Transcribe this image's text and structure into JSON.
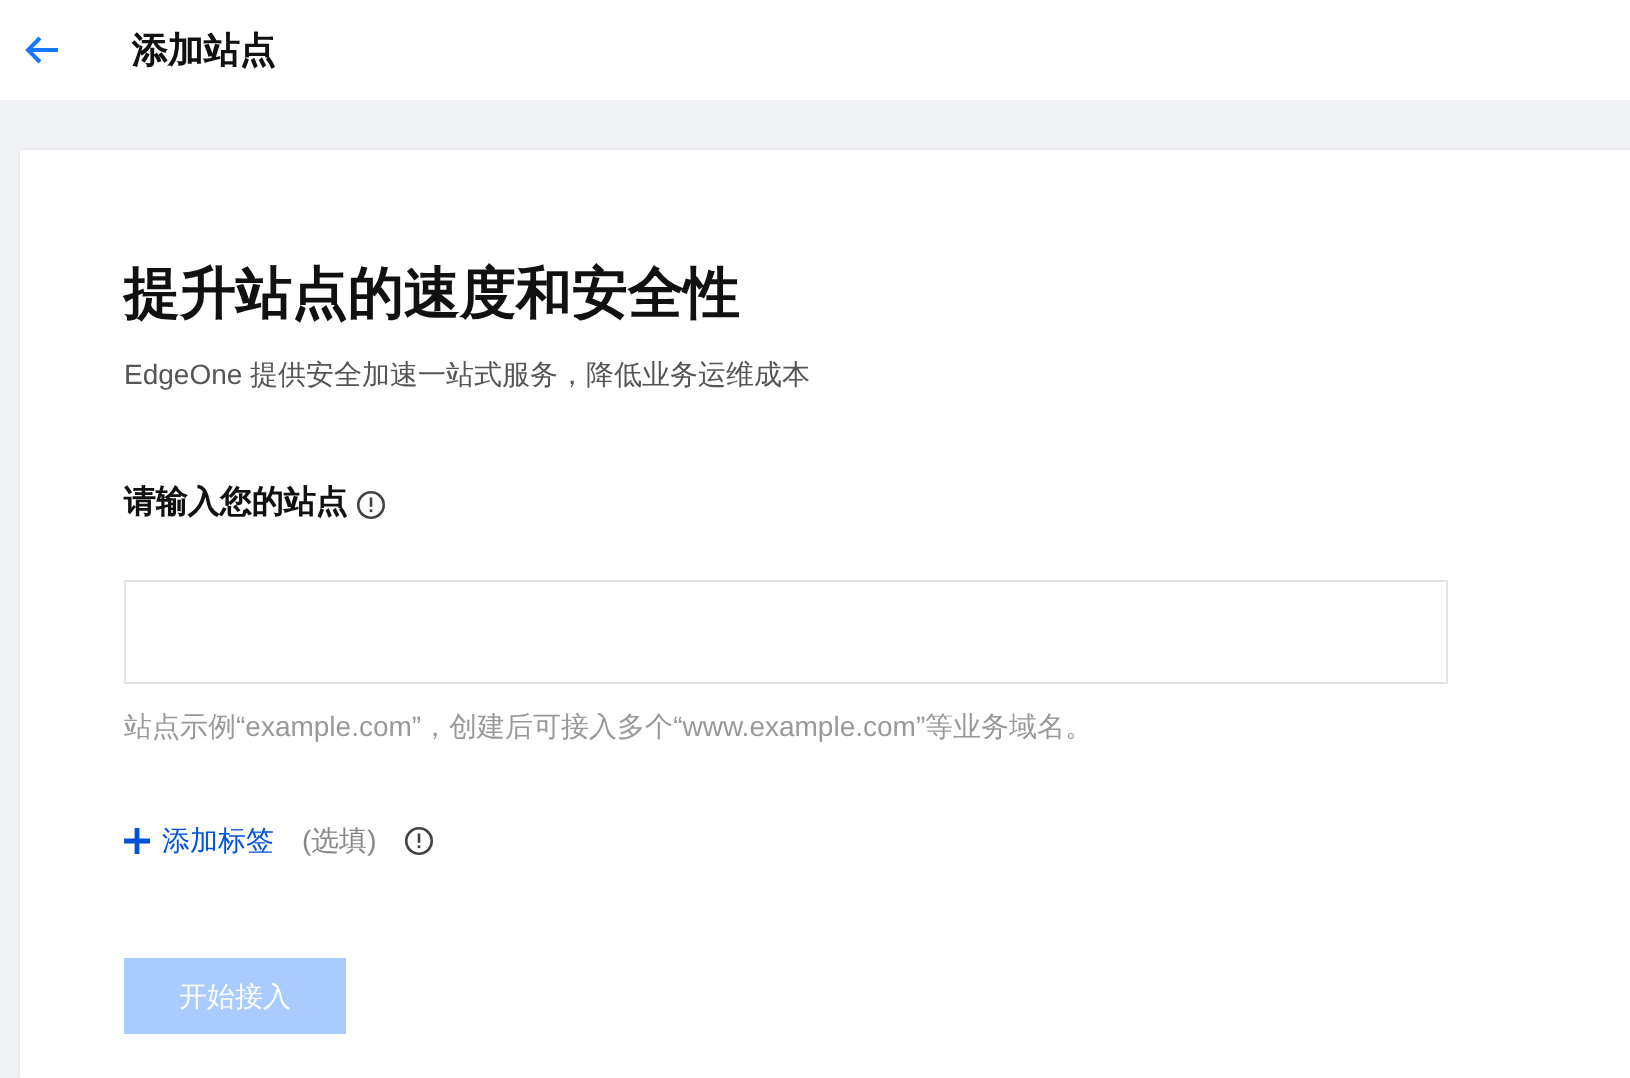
{
  "header": {
    "title": "添加站点"
  },
  "card": {
    "title": "提升站点的速度和安全性",
    "subtitle": "EdgeOne 提供安全加速一站式服务，降低业务运维成本",
    "site_field": {
      "label": "请输入您的站点",
      "hint": "站点示例“example.com”，创建后可接入多个“www.example.com”等业务域名。"
    },
    "add_tag": {
      "label": "添加标签",
      "optional": "(选填)"
    },
    "submit": {
      "label": "开始接入",
      "disabled": true
    }
  }
}
